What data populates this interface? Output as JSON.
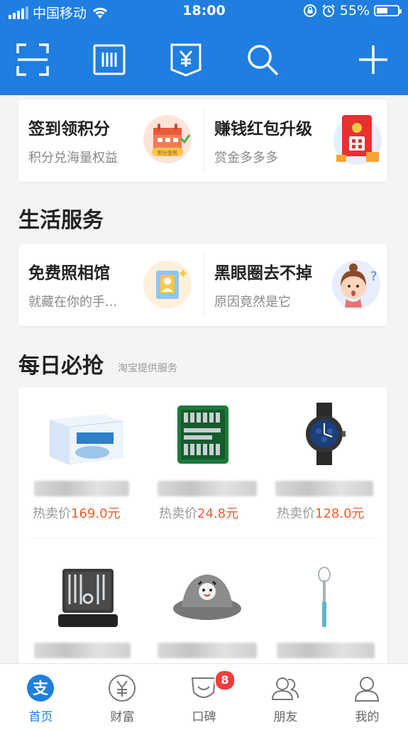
{
  "status": {
    "carrier": "中国移动",
    "time": "18:00",
    "battery": "55%",
    "battery_level": 0.55
  },
  "header": {
    "icons": [
      "scan-icon",
      "barcode-icon",
      "bill-icon",
      "search-icon",
      "plus-icon"
    ]
  },
  "promo_card": [
    {
      "title": "签到领积分",
      "subtitle": "积分兑海量权益",
      "badge_text": "积分签到"
    },
    {
      "title": "赚钱红包升级",
      "subtitle": "赏金多多多"
    }
  ],
  "life_services": {
    "title": "生活服务",
    "items": [
      {
        "title": "免费照相馆",
        "subtitle": "就藏在你的手..."
      },
      {
        "title": "黑眼圈去不掉",
        "subtitle": "原因竟然是它"
      }
    ]
  },
  "daily_deals": {
    "title": "每日必抢",
    "subtitle": "淘宝提供服务",
    "products": [
      {
        "price_label": "热卖价",
        "price": "169.0元"
      },
      {
        "price_label": "热卖价",
        "price": "24.8元"
      },
      {
        "price_label": "热卖价",
        "price": "128.0元"
      },
      {
        "price_label": "",
        "price": ""
      },
      {
        "price_label": "",
        "price": ""
      },
      {
        "price_label": "",
        "price": ""
      }
    ]
  },
  "tabbar": {
    "tabs": [
      {
        "label": "首页",
        "icon": "alipay-icon",
        "active": true
      },
      {
        "label": "财富",
        "icon": "wealth-icon"
      },
      {
        "label": "口碑",
        "icon": "koubei-icon"
      },
      {
        "label": "朋友",
        "icon": "friends-icon",
        "badge": "8"
      },
      {
        "label": "我的",
        "icon": "profile-icon"
      }
    ]
  },
  "colors": {
    "primary": "#1f7ee0",
    "price": "#f25c30",
    "badge": "#f23c3c"
  }
}
